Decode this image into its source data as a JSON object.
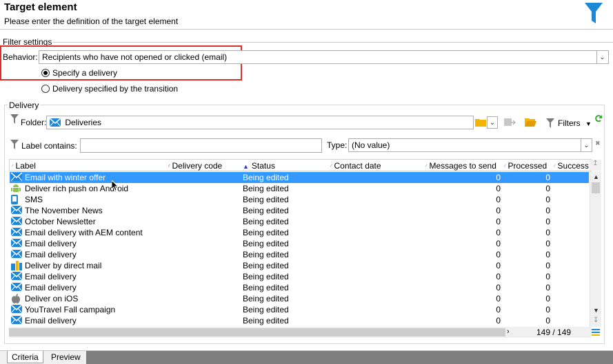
{
  "header": {
    "title": "Target element",
    "subtitle": "Please enter the definition of the target element",
    "funnel_color": "#1e88d8"
  },
  "filter_settings": {
    "section_label": "Filter settings",
    "behavior_label": "Behavior:",
    "behavior_value": "Recipients who have not opened or clicked (email)",
    "radio_specify": "Specify a delivery",
    "radio_transition": "Delivery specified by the transition",
    "highlight_color": "#d9302a"
  },
  "delivery": {
    "section_label": "Delivery",
    "folder_label": "Folder:",
    "folder_value": "Deliveries",
    "filters_label": "Filters",
    "label_contains": "Label contains:",
    "label_contains_value": "",
    "type_label": "Type:",
    "type_value": "(No value)"
  },
  "table": {
    "columns": [
      "Label",
      "Delivery code",
      "Status",
      "Contact date",
      "Messages to send",
      "Processed",
      "Success"
    ],
    "rows": [
      {
        "icon": "email-icon",
        "label": "Email with winter offer",
        "status": "Being edited",
        "to_send": "0",
        "processed": "0"
      },
      {
        "icon": "android-icon",
        "label": "Deliver rich push on Android",
        "status": "Being edited",
        "to_send": "0",
        "processed": "0"
      },
      {
        "icon": "sms-icon",
        "label": "SMS",
        "status": "Being edited",
        "to_send": "0",
        "processed": "0"
      },
      {
        "icon": "email-icon",
        "label": "The November News",
        "status": "Being edited",
        "to_send": "0",
        "processed": "0"
      },
      {
        "icon": "email-icon",
        "label": "October Newsletter",
        "status": "Being edited",
        "to_send": "0",
        "processed": "0"
      },
      {
        "icon": "email-icon",
        "label": "Email delivery with AEM content",
        "status": "Being edited",
        "to_send": "0",
        "processed": "0"
      },
      {
        "icon": "email-icon",
        "label": "Email delivery",
        "status": "Being edited",
        "to_send": "0",
        "processed": "0"
      },
      {
        "icon": "email-icon",
        "label": "Email delivery",
        "status": "Being edited",
        "to_send": "0",
        "processed": "0"
      },
      {
        "icon": "direct-mail-icon",
        "label": "Deliver by direct mail",
        "status": "Being edited",
        "to_send": "0",
        "processed": "0"
      },
      {
        "icon": "email-icon",
        "label": "Email delivery",
        "status": "Being edited",
        "to_send": "0",
        "processed": "0"
      },
      {
        "icon": "email-icon",
        "label": "Email delivery",
        "status": "Being edited",
        "to_send": "0",
        "processed": "0"
      },
      {
        "icon": "apple-icon",
        "label": "Deliver on iOS",
        "status": "Being edited",
        "to_send": "0",
        "processed": "0"
      },
      {
        "icon": "email-icon",
        "label": "YouTravel Fall campaign",
        "status": "Being edited",
        "to_send": "0",
        "processed": "0"
      },
      {
        "icon": "email-icon",
        "label": "Email delivery",
        "status": "Being edited",
        "to_send": "0",
        "processed": "0"
      }
    ],
    "count": "149 / 149",
    "selected_row_color": "#3399ff"
  },
  "tabs": [
    "Criteria",
    "Preview"
  ]
}
